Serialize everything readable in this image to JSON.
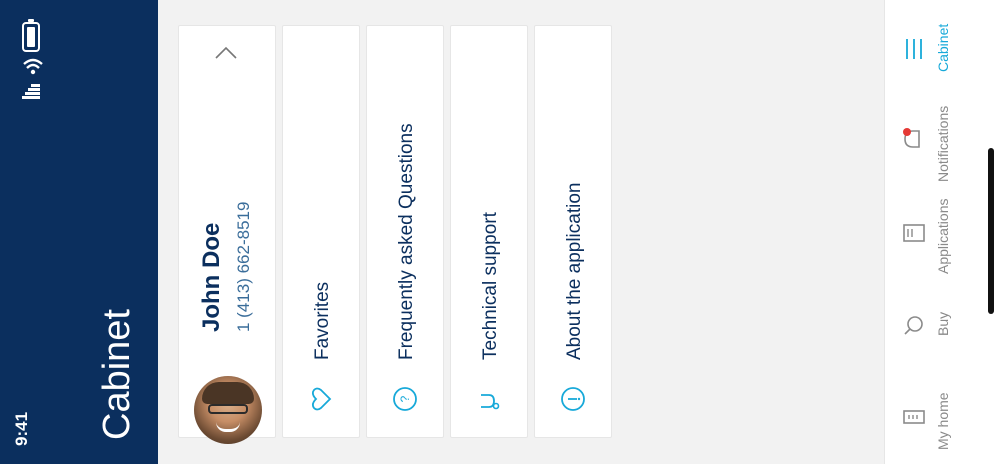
{
  "status": {
    "time": "9:41"
  },
  "header": {
    "title": "Cabinet"
  },
  "profile": {
    "name": "John Doe",
    "phone": "1 (413) 662-8519"
  },
  "menu": {
    "favorites": "Favorites",
    "faq": "Frequently asked Questions",
    "support": "Technical support",
    "about": "About the application"
  },
  "nav": {
    "items": [
      {
        "label": "Cabinet",
        "icon": "menu-icon",
        "active": true
      },
      {
        "label": "Notifications",
        "icon": "bell-icon",
        "badge": true
      },
      {
        "label": "Applications",
        "icon": "document-icon"
      },
      {
        "label": "Buy",
        "icon": "search-icon"
      },
      {
        "label": "My home",
        "icon": "home-icon"
      }
    ]
  },
  "colors": {
    "primary": "#0b2f5e",
    "accent": "#17a9d9",
    "badge": "#e53935"
  }
}
